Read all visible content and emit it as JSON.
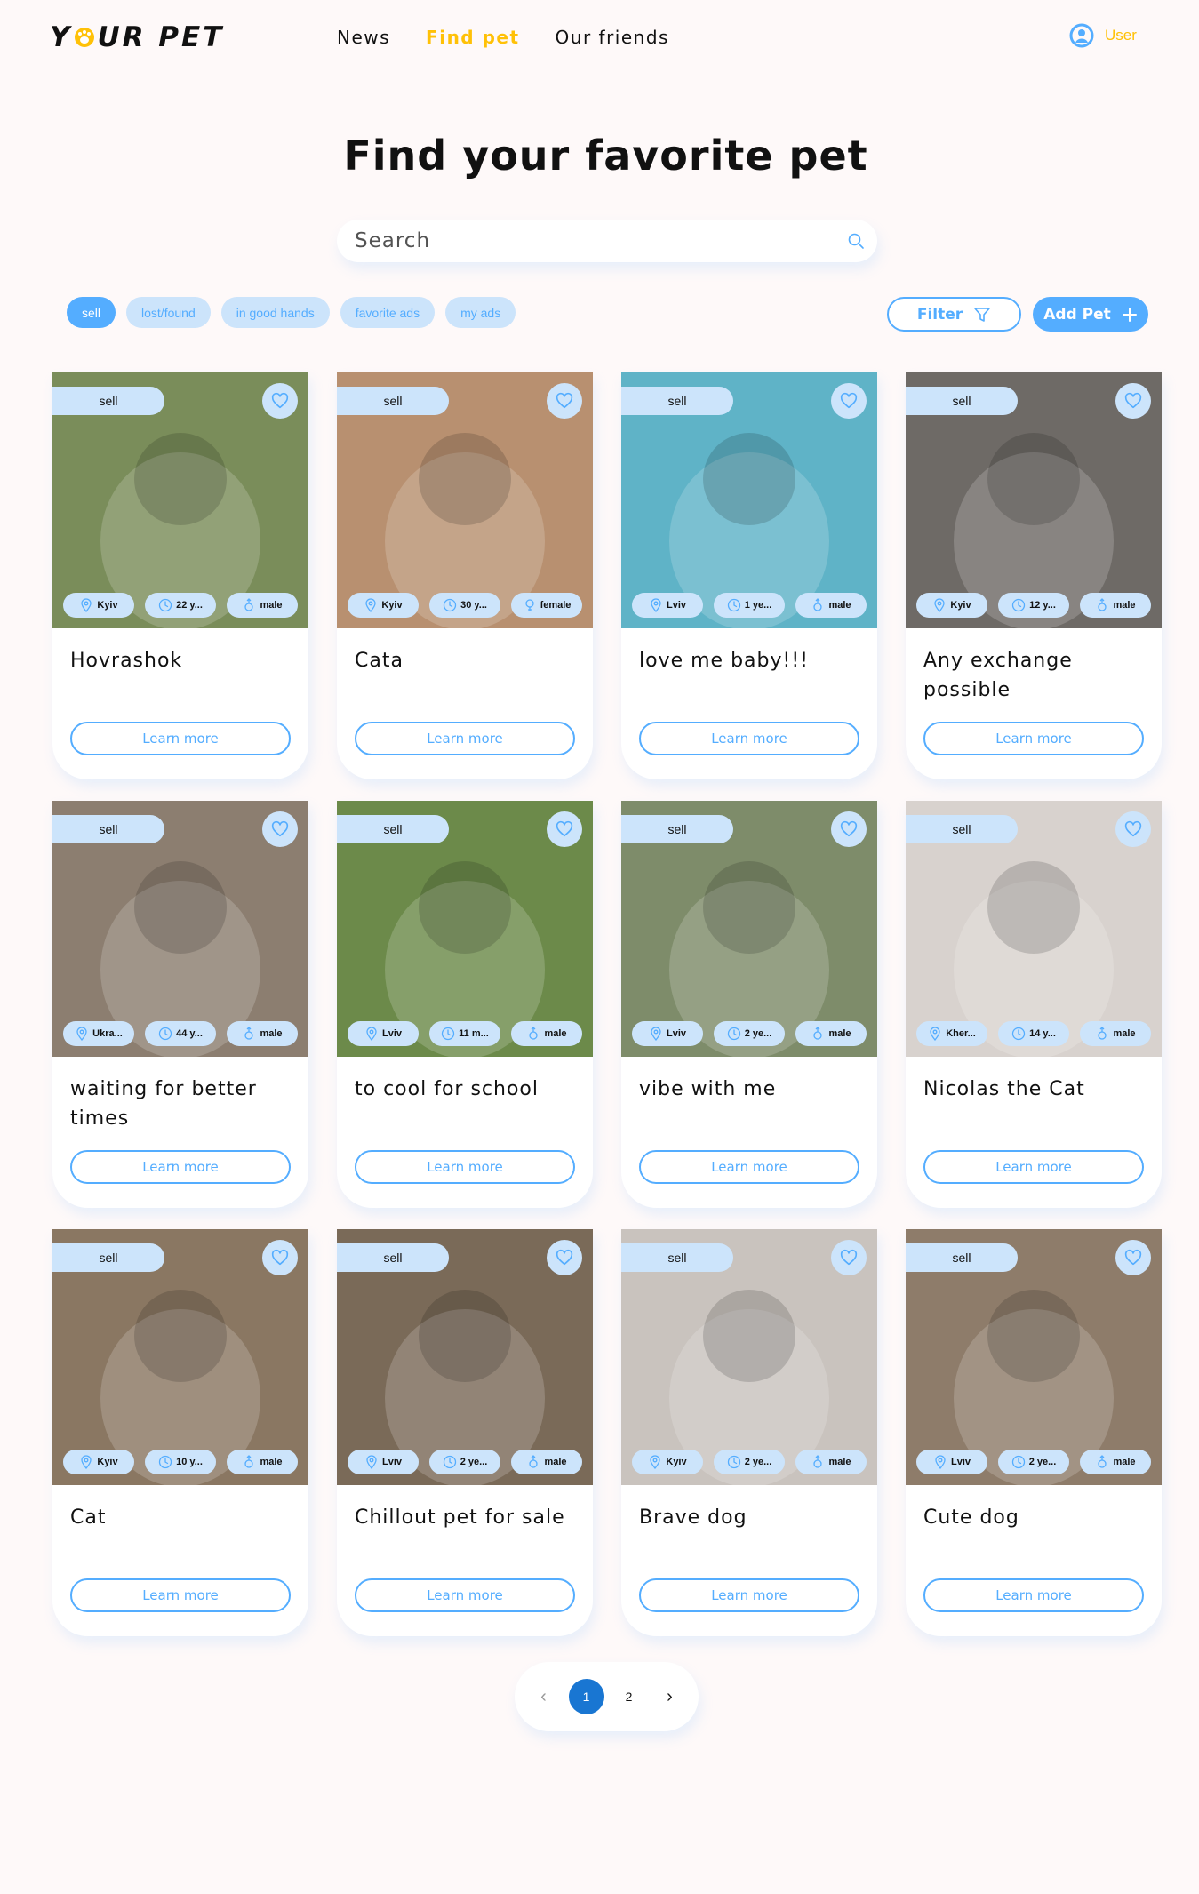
{
  "header": {
    "logo": "YOUR PET",
    "nav": [
      {
        "label": "News",
        "active": false
      },
      {
        "label": "Find pet",
        "active": true
      },
      {
        "label": "Our friends",
        "active": false
      }
    ],
    "user_label": "User"
  },
  "title": "Find your favorite pet",
  "search": {
    "placeholder": "Search",
    "value": ""
  },
  "chips": [
    {
      "label": "sell",
      "active": true
    },
    {
      "label": "lost/found",
      "active": false
    },
    {
      "label": "in good hands",
      "active": false
    },
    {
      "label": "favorite ads",
      "active": false
    },
    {
      "label": "my ads",
      "active": false
    }
  ],
  "filter_label": "Filter",
  "add_pet_label": "Add Pet",
  "cards": [
    {
      "category": "sell",
      "title": "Hovrashok",
      "location": "Kyiv",
      "age": "22 y...",
      "sex": "male",
      "learn": "Learn more",
      "bg": "#7A8D5A"
    },
    {
      "category": "sell",
      "title": "Cata",
      "location": "Kyiv",
      "age": "30 y...",
      "sex": "female",
      "learn": "Learn more",
      "bg": "#B89070"
    },
    {
      "category": "sell",
      "title": "love me baby!!!",
      "location": "Lviv",
      "age": "1 ye...",
      "sex": "male",
      "learn": "Learn more",
      "bg": "#5FB3C7"
    },
    {
      "category": "sell",
      "title": "Any exchange possible",
      "location": "Kyiv",
      "age": "12 y...",
      "sex": "male",
      "learn": "Learn more",
      "bg": "#6E6A66"
    },
    {
      "category": "sell",
      "title": "waiting for better times",
      "location": "Ukra...",
      "age": "44 y...",
      "sex": "male",
      "learn": "Learn more",
      "bg": "#8C7E70"
    },
    {
      "category": "sell",
      "title": "to cool for school",
      "location": "Lviv",
      "age": "11 m...",
      "sex": "male",
      "learn": "Learn more",
      "bg": "#6C8A4A"
    },
    {
      "category": "sell",
      "title": "vibe with me",
      "location": "Lviv",
      "age": "2 ye...",
      "sex": "male",
      "learn": "Learn more",
      "bg": "#7E8C6A"
    },
    {
      "category": "sell",
      "title": "Nicolas the Cat",
      "location": "Kher...",
      "age": "14 y...",
      "sex": "male",
      "learn": "Learn more",
      "bg": "#D8D2CE"
    },
    {
      "category": "sell",
      "title": "Cat",
      "location": "Kyiv",
      "age": "10 y...",
      "sex": "male",
      "learn": "Learn more",
      "bg": "#8A7762"
    },
    {
      "category": "sell",
      "title": "Chillout pet for sale",
      "location": "Lviv",
      "age": "2 ye...",
      "sex": "male",
      "learn": "Learn more",
      "bg": "#7A6A58"
    },
    {
      "category": "sell",
      "title": "Brave dog",
      "location": "Kyiv",
      "age": "2 ye...",
      "sex": "male",
      "learn": "Learn more",
      "bg": "#C9C3BE"
    },
    {
      "category": "sell",
      "title": "Cute dog",
      "location": "Lviv",
      "age": "2 ye...",
      "sex": "male",
      "learn": "Learn more",
      "bg": "#8E7C6A"
    }
  ],
  "pagination": {
    "prev": "‹",
    "pages": [
      "1",
      "2"
    ],
    "current": "1",
    "next": "›"
  },
  "colors": {
    "accent": "#54ADFF",
    "accent_light": "#CCE4FB",
    "yellow": "#FFC107",
    "page_active": "#1976D2",
    "background": "#FEF9F9"
  }
}
